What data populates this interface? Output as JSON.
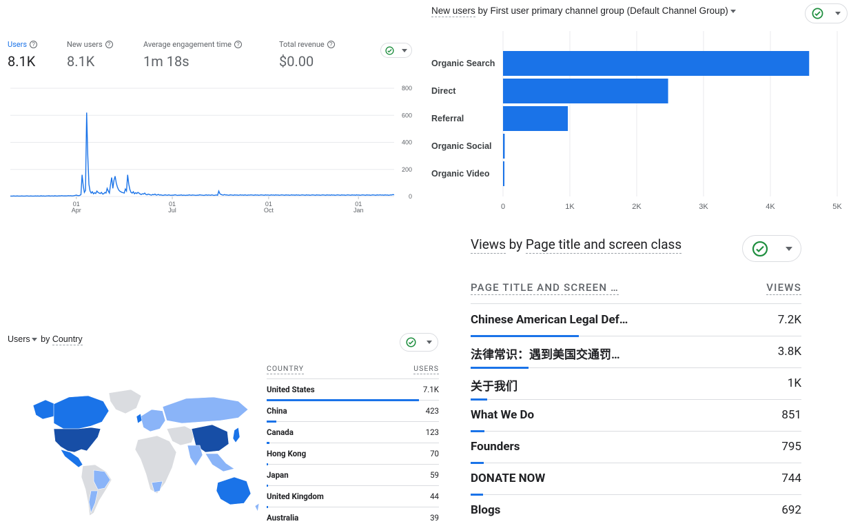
{
  "overview": {
    "metrics": [
      {
        "label": "Users",
        "value": "8.1K"
      },
      {
        "label": "New users",
        "value": "8.1K"
      },
      {
        "label": "Average engagement time",
        "value": "1m 18s"
      },
      {
        "label": "Total revenue",
        "value": "$0.00"
      }
    ],
    "help_glyph": "?"
  },
  "line_chart": {
    "y_ticks": [
      "800",
      "600",
      "400",
      "200",
      "0"
    ],
    "x_ticks": [
      {
        "day": "01",
        "month": "Apr"
      },
      {
        "day": "01",
        "month": "Jul"
      },
      {
        "day": "01",
        "month": "Oct"
      },
      {
        "day": "01",
        "month": "Jan"
      }
    ]
  },
  "channel_card": {
    "title_part1": "New users",
    "title_part2": " by First user primary channel group (Default Channel Group)",
    "x_ticks": [
      "0",
      "1K",
      "2K",
      "3K",
      "4K",
      "5K"
    ]
  },
  "views_card": {
    "title_part1": "Views",
    "title_part2": " by ",
    "title_part3": "Page title and screen class",
    "col_title": "PAGE TITLE AND SCREEN …",
    "col_views": "VIEWS",
    "rows": [
      {
        "title": "Chinese American Legal Def…",
        "views": "7.2K"
      },
      {
        "title": "法律常识：遇到美国交通罚…",
        "views": "3.8K"
      },
      {
        "title": "关于我们",
        "views": "1K"
      },
      {
        "title": "What We Do",
        "views": "851"
      },
      {
        "title": "Founders",
        "views": "795"
      },
      {
        "title": "DONATE NOW",
        "views": "744"
      },
      {
        "title": "Blogs",
        "views": "692"
      }
    ]
  },
  "country_card": {
    "title_part1": "Users",
    "title_part2": " by ",
    "title_part3": "Country",
    "col_country": "COUNTRY",
    "col_users": "USERS",
    "rows": [
      {
        "country": "United States",
        "users": "7.1K"
      },
      {
        "country": "China",
        "users": "423"
      },
      {
        "country": "Canada",
        "users": "123"
      },
      {
        "country": "Hong Kong",
        "users": "70"
      },
      {
        "country": "Japan",
        "users": "59"
      },
      {
        "country": "United Kingdom",
        "users": "44"
      },
      {
        "country": "Australia",
        "users": "39"
      }
    ]
  },
  "chart_data": [
    {
      "type": "line",
      "series": [
        {
          "values": [
            3,
            3,
            3,
            4,
            3,
            3,
            4,
            3,
            3,
            3,
            4,
            3,
            3,
            3,
            4,
            4,
            3,
            3,
            4,
            3,
            3,
            3,
            4,
            3,
            4,
            3,
            3,
            5,
            3,
            4,
            3,
            3,
            4,
            4,
            5,
            3,
            4,
            4,
            3,
            5,
            4,
            3,
            4,
            5,
            4,
            6,
            5,
            4,
            5,
            4,
            5,
            6,
            5,
            6,
            4,
            5,
            6,
            8,
            10,
            7,
            6,
            8,
            14,
            160,
            80,
            30,
            45,
            620,
            300,
            90,
            40,
            25,
            35,
            20,
            28,
            22,
            40,
            30,
            25,
            22,
            30,
            18,
            20,
            30,
            25,
            60,
            40,
            25,
            90,
            140,
            60,
            120,
            150,
            100,
            70,
            50,
            40,
            35,
            30,
            28,
            25,
            55,
            40,
            160,
            90,
            50,
            30,
            25,
            35,
            20,
            28,
            22,
            30,
            25,
            18,
            15,
            20,
            18,
            25,
            15,
            12,
            18,
            15,
            12,
            10,
            15,
            12,
            18,
            10,
            12,
            15,
            10,
            12,
            10,
            8,
            10,
            12,
            10,
            9,
            12,
            10,
            8,
            10,
            9,
            11,
            12,
            9,
            8,
            10,
            9,
            12,
            8,
            10,
            9,
            8,
            10,
            9,
            12,
            10,
            9,
            11,
            10,
            9,
            8,
            10,
            9,
            12,
            11,
            10,
            9,
            8,
            10,
            12,
            9,
            11,
            10,
            9,
            12,
            9,
            8,
            10,
            11,
            9,
            40,
            20,
            15,
            12,
            10,
            14,
            11,
            12,
            10,
            9,
            12,
            11,
            10,
            9,
            12,
            10,
            11,
            9,
            10,
            12,
            10,
            11,
            9,
            12,
            10,
            9,
            11,
            10,
            12,
            11,
            10,
            9,
            12,
            10,
            11,
            9,
            10,
            12,
            11,
            10,
            9,
            12,
            10,
            11,
            10,
            9,
            12,
            10,
            11,
            9,
            12,
            10,
            11,
            9,
            10,
            12,
            11,
            10,
            9,
            12,
            10,
            11,
            9,
            10,
            12,
            10,
            11,
            9,
            12,
            10,
            11,
            9,
            10,
            12,
            11,
            10,
            9,
            12,
            10,
            11,
            9,
            10,
            12,
            11,
            10,
            9,
            12,
            10,
            11,
            9,
            10,
            12,
            11,
            10,
            9,
            12,
            10,
            11,
            9,
            12,
            10,
            11,
            9,
            10,
            12,
            11,
            10,
            9,
            12,
            10,
            11,
            9,
            10,
            12,
            11,
            10,
            9,
            12,
            10,
            11,
            9,
            12,
            10,
            11,
            9,
            10,
            12,
            11,
            10,
            9,
            12,
            10,
            11,
            9,
            10,
            12,
            11,
            10,
            9,
            12,
            10,
            11,
            12,
            10,
            11,
            9,
            12,
            10,
            11,
            9,
            10,
            12,
            11,
            14,
            12
          ]
        }
      ],
      "x_ticks": [
        "01 Apr",
        "01 Jul",
        "01 Oct",
        "01 Jan"
      ],
      "ylim": [
        0,
        800
      ]
    },
    {
      "type": "bar",
      "orientation": "horizontal",
      "categories": [
        "Organic Search",
        "Direct",
        "Referral",
        "Organic Social",
        "Organic Video"
      ],
      "values": [
        4580,
        2470,
        970,
        25,
        12
      ],
      "xlim": [
        0,
        5000
      ],
      "color": "#1a73e8"
    }
  ],
  "colors": {
    "accent": "#1a73e8",
    "map_dark": "#174ea6",
    "map_mid": "#1a73e8",
    "map_light": "#8ab4f8",
    "map_none": "#dadce0"
  }
}
